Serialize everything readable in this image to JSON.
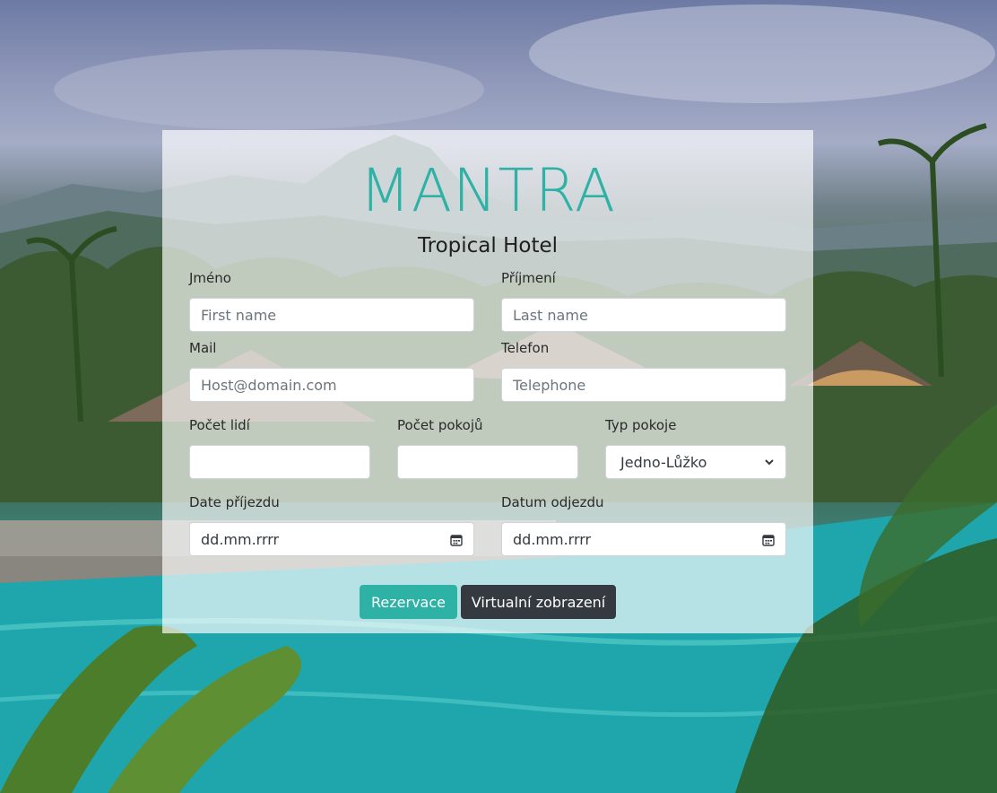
{
  "hotel": {
    "brand": "MANTRA",
    "subtitle": "Tropical Hotel"
  },
  "form": {
    "first_name": {
      "label": "Jméno",
      "placeholder": "First name",
      "value": ""
    },
    "last_name": {
      "label": "Příjmení",
      "placeholder": "Last name",
      "value": ""
    },
    "mail": {
      "label": "Mail",
      "placeholder": "Host@domain.com",
      "value": ""
    },
    "phone": {
      "label": "Telefon",
      "placeholder": "Telephone",
      "value": ""
    },
    "people": {
      "label": "Počet lidí",
      "value": ""
    },
    "rooms": {
      "label": "Počet pokojů",
      "value": ""
    },
    "room_type": {
      "label": "Typ pokoje",
      "selected": "Jedno-Lůžko"
    },
    "arrival": {
      "label": "Date příjezdu",
      "value": "dd.mm.rrrr"
    },
    "departure": {
      "label": "Datum odjezdu",
      "value": "dd.mm.rrrr"
    }
  },
  "buttons": {
    "reserve": "Rezervace",
    "virtual": "Virtualní zobrazení"
  },
  "colors": {
    "accent": "#2fb2a6",
    "dark": "#343a40"
  }
}
